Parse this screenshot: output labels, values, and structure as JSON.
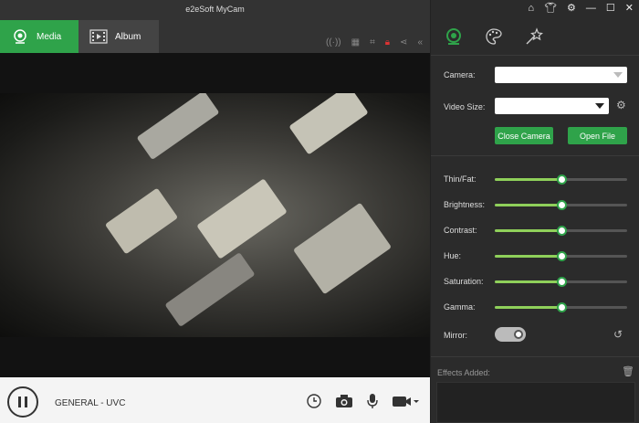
{
  "app": {
    "title": "e2eSoft MyCam"
  },
  "tabs": {
    "media": "Media",
    "album": "Album"
  },
  "device": {
    "name": "GENERAL - UVC"
  },
  "settings": {
    "camera_label": "Camera:",
    "camera_value": "",
    "video_size_label": "Video Size:",
    "video_size_value": "",
    "close_camera": "Close Camera",
    "open_file": "Open File"
  },
  "sliders": [
    {
      "label": "Thin/Fat:",
      "value": 0.5
    },
    {
      "label": "Brightness:",
      "value": 0.5
    },
    {
      "label": "Contrast:",
      "value": 0.5
    },
    {
      "label": "Hue:",
      "value": 0.5
    },
    {
      "label": "Saturation:",
      "value": 0.5
    },
    {
      "label": "Gamma:",
      "value": 0.5
    }
  ],
  "mirror": {
    "label": "Mirror:",
    "on": true
  },
  "effects": {
    "label": "Effects Added:"
  },
  "colors": {
    "accent": "#2fa34a",
    "slider_fill": "#8fd05a",
    "lock": "#dd3333"
  },
  "icons": [
    "home-icon",
    "shirt-icon",
    "gear-icon",
    "minimize-icon",
    "maximize-icon",
    "close-icon",
    "webcam-icon",
    "palette-icon",
    "magic-wand-icon",
    "broadcast-icon",
    "qr-code-icon",
    "crop-icon",
    "lock-icon",
    "share-icon",
    "collapse-icon",
    "pause-icon",
    "timer-icon",
    "camera-icon",
    "microphone-icon",
    "video-camera-icon",
    "reset-icon",
    "trash-icon"
  ]
}
